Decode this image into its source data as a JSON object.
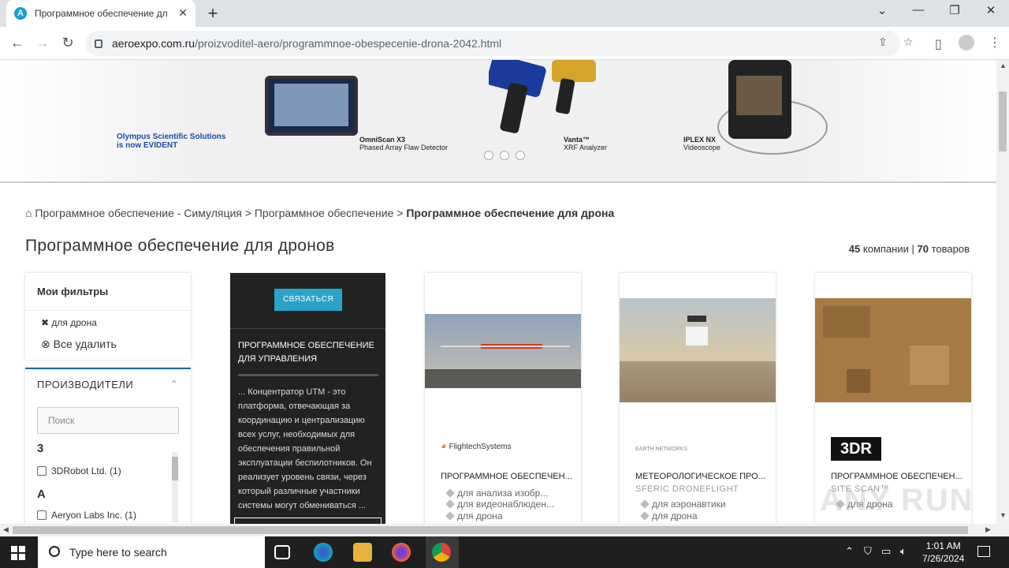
{
  "browser": {
    "tab_title": "Программное обеспечение дл",
    "tab_favicon": "A",
    "url_domain": "aeroexpo.com.ru",
    "url_path": "/proizvoditel-aero/programmnoe-obespecenie-drona-2042.html"
  },
  "banner": {
    "brand_line1": "Olympus Scientific Solutions",
    "brand_line2": "is now EVIDENT",
    "products": [
      {
        "name": "OmniScan X3",
        "desc": "Phased Array Flaw Detector"
      },
      {
        "name": "Vanta™",
        "desc": "XRF Analyzer"
      },
      {
        "name": "IPLEX NX",
        "desc": "Videoscope"
      }
    ]
  },
  "breadcrumb": {
    "item1": "Программное обеспечение - Симуляция",
    "sep": ">",
    "item2": "Программное обеспечение",
    "current": "Программное обеспечение для дрона"
  },
  "heading": "Программное обеспечение для дронов",
  "counts": {
    "companies_num": "45",
    "companies_label": "компании",
    "sep": "|",
    "products_num": "70",
    "products_label": "товаров"
  },
  "filters": {
    "title": "Мои фильтры",
    "active": "для дрона",
    "remove_all": "Все удалить"
  },
  "manufacturers": {
    "title": "ПРОИЗВОДИТЕЛИ",
    "search_placeholder": "Поиск",
    "letter1": "3",
    "item1": "3DRobot Ltd. (1)",
    "letter2": "A",
    "item2": "Aeryon Labs Inc. (1)"
  },
  "cards": {
    "featured": {
      "button": "СВЯЗАТЬСЯ",
      "title": "ПРОГРАММНОЕ ОБЕСПЕЧЕНИЕ ДЛЯ УПРАВЛЕНИЯ",
      "desc": "... Концентратор UTM - это платформа, отвечающая за координацию и централизацию всех услуг, необходимых для обеспечения правильной эксплуатации беспилотников. Он реализует уровень связи, через который различные участники системы могут обмениваться ..."
    },
    "c1": {
      "logo": "FlightechSystems",
      "title": "ПРОГРАММНОЕ ОБЕСПЕЧЕН...",
      "tags": [
        "для анализа изобр...",
        "для видеонаблюден...",
        "для дрона"
      ]
    },
    "c2": {
      "logo": "EARTH NETWORKS",
      "title": "МЕТЕОРОЛОГИЧЕСКОЕ ПРО...",
      "sub": "SFERIC DRONEFLIGHT",
      "tags": [
        "для аэронавтики",
        "для дрона"
      ]
    },
    "c3": {
      "logo": "3DR",
      "title": "ПРОГРАММНОЕ ОБЕСПЕЧЕН...",
      "sub": "SITE SCAN™",
      "tags": [
        "для дрона"
      ]
    }
  },
  "taskbar": {
    "search": "Type here to search",
    "time": "1:01 AM",
    "date": "7/26/2024"
  },
  "watermark": "ANY RUN"
}
